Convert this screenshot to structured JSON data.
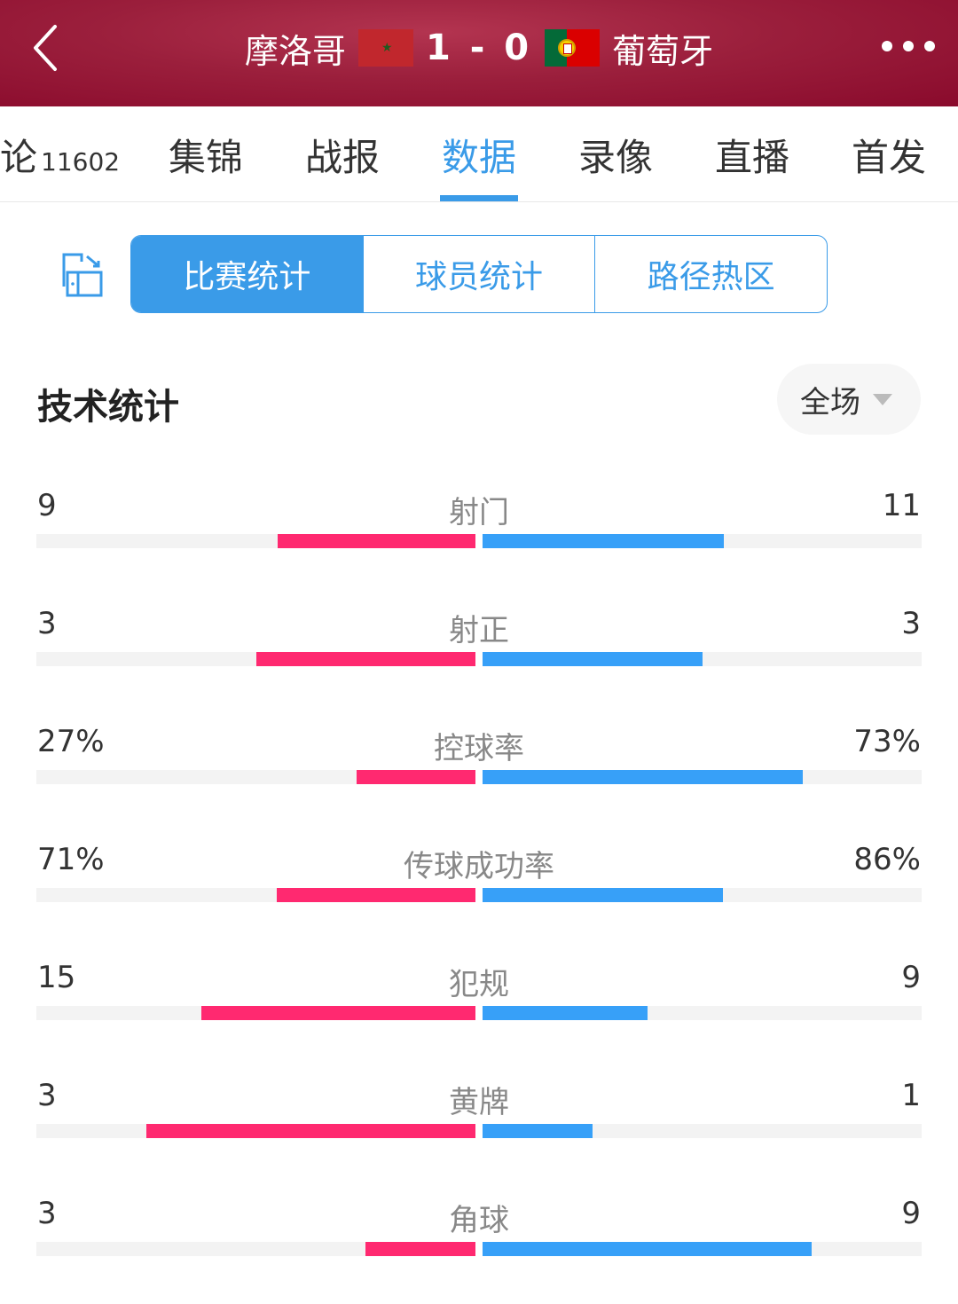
{
  "header": {
    "home_team": "摩洛哥",
    "away_team": "葡萄牙",
    "score": "1 - 0",
    "home_flag": "morocco-flag",
    "away_flag": "portugal-flag"
  },
  "tabs": [
    {
      "label": "论",
      "count": "11602"
    },
    {
      "label": "集锦"
    },
    {
      "label": "战报"
    },
    {
      "label": "数据",
      "active": true
    },
    {
      "label": "录像"
    },
    {
      "label": "直播"
    },
    {
      "label": "首发"
    }
  ],
  "segments": [
    {
      "label": "比赛统计",
      "active": true
    },
    {
      "label": "球员统计"
    },
    {
      "label": "路径热区"
    }
  ],
  "section": {
    "title": "技术统计",
    "period": "全场"
  },
  "colors": {
    "accent": "#3a9be8",
    "home_bar": "#ff2970",
    "away_bar": "#37a0f8",
    "header_bg": "#9b1f3c"
  },
  "stats": [
    {
      "name": "射门",
      "home": "9",
      "away": "11",
      "home_frac": 0.45,
      "away_frac": 0.55
    },
    {
      "name": "射正",
      "home": "3",
      "away": "3",
      "home_frac": 0.5,
      "away_frac": 0.5
    },
    {
      "name": "控球率",
      "home": "27%",
      "away": "73%",
      "home_frac": 0.27,
      "away_frac": 0.73
    },
    {
      "name": "传球成功率",
      "home": "71%",
      "away": "86%",
      "home_frac": 0.452,
      "away_frac": 0.548
    },
    {
      "name": "犯规",
      "home": "15",
      "away": "9",
      "home_frac": 0.625,
      "away_frac": 0.375
    },
    {
      "name": "黄牌",
      "home": "3",
      "away": "1",
      "home_frac": 0.75,
      "away_frac": 0.25
    },
    {
      "name": "角球",
      "home": "3",
      "away": "9",
      "home_frac": 0.25,
      "away_frac": 0.75
    }
  ]
}
